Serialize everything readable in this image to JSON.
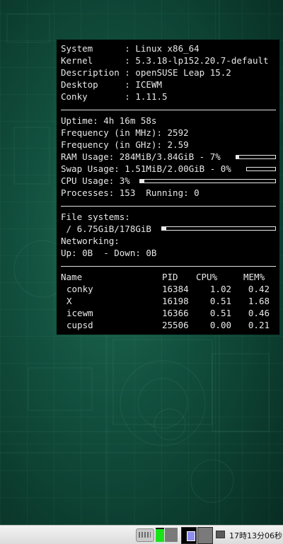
{
  "conky": {
    "system_info": [
      {
        "label": "System     ",
        "value": "Linux x86_64"
      },
      {
        "label": "Kernel     ",
        "value": "5.3.18-lp152.20.7-default"
      },
      {
        "label": "Description",
        "value": "openSUSE Leap 15.2"
      },
      {
        "label": "Desktop    ",
        "value": "ICEWM"
      },
      {
        "label": "Conky      ",
        "value": "1.11.5"
      }
    ],
    "uptime": "Uptime: 4h 16m 58s",
    "freq_mhz": "Frequency (in MHz): 2592",
    "freq_ghz": "Frequency (in GHz): 2.59",
    "ram": {
      "text": "RAM Usage: 284MiB/3.84GiB - 7%",
      "percent": 7
    },
    "swap": {
      "text": "Swap Usage: 1.51MiB/2.00GiB - 0%",
      "percent": 0
    },
    "cpu": {
      "text": "CPU Usage: 3%",
      "percent": 3
    },
    "processes": "Processes: 153  Running: 0",
    "filesystems_label": "File systems:",
    "fs_root": {
      "text": " / 6.75GiB/178GiB",
      "percent": 3.8
    },
    "networking_label": "Networking:",
    "net": "Up: 0B  - Down: 0B",
    "proc_headers": {
      "name": "Name",
      "pid": "PID",
      "cpu": "CPU%",
      "mem": "MEM%"
    },
    "processes_table": [
      {
        "name": "conky",
        "pid": "16384",
        "cpu": "1.02",
        "mem": "0.42"
      },
      {
        "name": "X",
        "pid": "16198",
        "cpu": "0.51",
        "mem": "1.68"
      },
      {
        "name": "icewm",
        "pid": "16366",
        "cpu": "0.51",
        "mem": "0.46"
      },
      {
        "name": "cupsd",
        "pid": "25506",
        "cpu": "0.00",
        "mem": "0.21"
      }
    ]
  },
  "taskbar": {
    "icons": [
      "keyboard-icon",
      "cpu-monitor-icon",
      "network-monitor-icon",
      "workspace-1",
      "workspace-2",
      "mail-icon"
    ],
    "cpu_monitor_level": 0.9,
    "clock": "17時13分06秒",
    "colors": {
      "cpu_fill": "#19e219",
      "workspace_window": "#8e8ef0"
    }
  }
}
